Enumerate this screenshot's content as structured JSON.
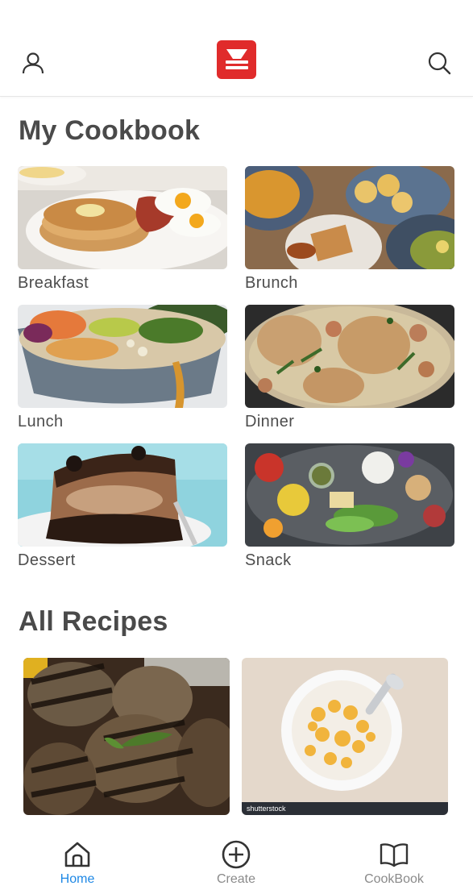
{
  "header": {
    "profile_icon": "user-icon",
    "logo_icon": "cookbook-logo",
    "search_icon": "search-icon",
    "brand_color": "#e02b2b"
  },
  "my_cookbook": {
    "title": "My Cookbook",
    "categories": [
      {
        "label": "Breakfast"
      },
      {
        "label": "Brunch"
      },
      {
        "label": "Lunch"
      },
      {
        "label": "Dinner"
      },
      {
        "label": "Dessert"
      },
      {
        "label": "Snack"
      }
    ]
  },
  "all_recipes": {
    "title": "All Recipes",
    "recipes": [
      {
        "image": "grilled-eggplant"
      },
      {
        "image": "cereal-bowl",
        "watermark": "shutterstock"
      }
    ]
  },
  "bottom_nav": {
    "items": [
      {
        "label": "Home",
        "icon": "home-icon",
        "active": true
      },
      {
        "label": "Create",
        "icon": "plus-circle-icon",
        "active": false
      },
      {
        "label": "CookBook",
        "icon": "book-icon",
        "active": false
      }
    ],
    "active_color": "#1e88e5"
  }
}
